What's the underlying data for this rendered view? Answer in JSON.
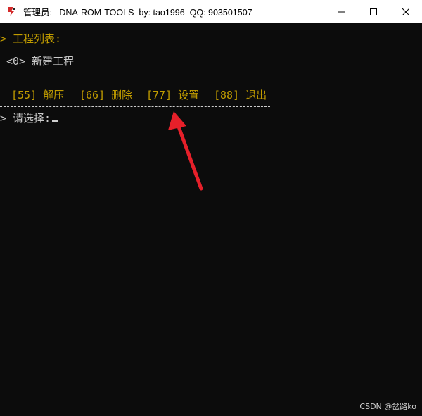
{
  "window": {
    "title": "管理员:   DNA-ROM-TOOLS  by: tao1996  QQ: 903501507",
    "controls": {
      "minimize_icon": "minimize-icon",
      "maximize_icon": "maximize-icon",
      "close_icon": "close-icon"
    }
  },
  "console": {
    "project_list_label": "> 工程列表:",
    "new_project_item": " <0> 新建工程",
    "menu": {
      "unpack": "[55] 解压",
      "delete": "[66] 删除",
      "settings": "[77] 设置",
      "exit": "[88] 退出"
    },
    "prompt": "> 请选择:"
  },
  "annotation": {
    "arrow_color": "#e6202a"
  },
  "watermark": "CSDN @岔路ko",
  "colors": {
    "console_bg": "#0c0c0c",
    "yellow_text": "#c19c00",
    "white_text": "#cccccc"
  }
}
